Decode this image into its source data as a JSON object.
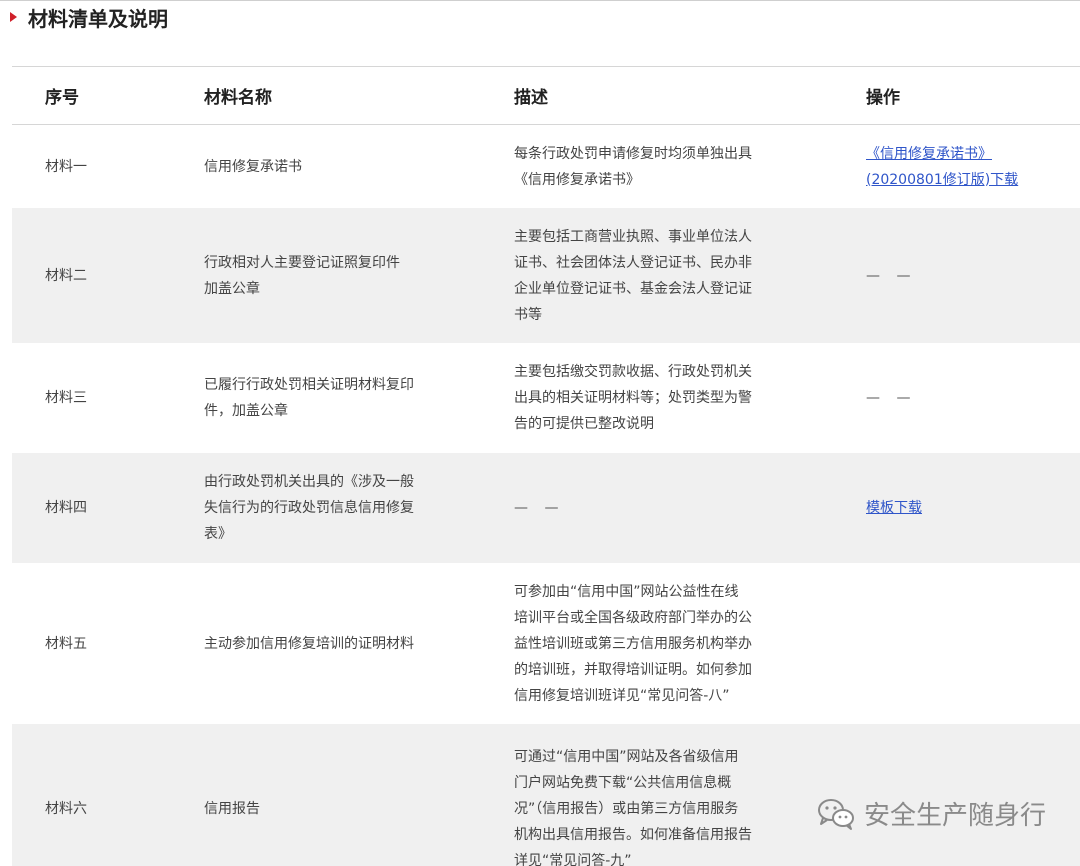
{
  "section": {
    "title": "材料清单及说明"
  },
  "table": {
    "headers": [
      "序号",
      "材料名称",
      "描述",
      "操作"
    ],
    "rows": [
      {
        "index": "材料一",
        "name": "信用修复承诺书",
        "description": "每条行政处罚申请修复时均须单独出具《信用修复承诺书》",
        "action": "《信用修复承诺书》(20200801修订版)下载"
      },
      {
        "index": "材料二",
        "name": "行政相对人主要登记证照复印件加盖公章",
        "description": "主要包括工商营业执照、事业单位法人证书、社会团体法人登记证书、民办非企业单位登记证书、基金会法人登记证书等",
        "action": "— —"
      },
      {
        "index": "材料三",
        "name": "已履行行政处罚相关证明材料复印件，加盖公章",
        "description": "主要包括缴交罚款收据、行政处罚机关出具的相关证明材料等；处罚类型为警告的可提供已整改说明",
        "action": "— —"
      },
      {
        "index": "材料四",
        "name": "由行政处罚机关出具的《涉及一般失信行为的行政处罚信息信用修复表》",
        "description": "— —",
        "action": "模板下载"
      },
      {
        "index": "材料五",
        "name": "主动参加信用修复培训的证明材料",
        "description": "可参加由“信用中国”网站公益性在线培训平台或全国各级政府部门举办的公益性培训班或第三方信用服务机构举办的培训班，并取得培训证明。如何参加信用修复培训班详见“常见问答-八”",
        "action": ""
      },
      {
        "index": "材料六",
        "name": "信用报告",
        "description": "可通过“信用中国”网站及各省级信用门户网站免费下载“公共信用信息概况”（信用报告）或由第三方信用服务机构出具信用报告。如何准备信用报告详见“常见问答-九”",
        "action": ""
      }
    ]
  },
  "lines": {
    "r1_desc": [
      "每条行政处罚申请修复时均须单独出具",
      "《信用修复承诺书》"
    ],
    "r1_action": [
      "《信用修复承诺书》",
      "(20200801修订版)下载"
    ],
    "r2_name": [
      "行政相对人主要登记证照复印件",
      "加盖公章"
    ],
    "r2_desc": [
      "主要包括工商营业执照、事业单位法人",
      "证书、社会团体法人登记证书、民办非",
      "企业单位登记证书、基金会法人登记证",
      "书等"
    ],
    "r3_name": [
      "已履行行政处罚相关证明材料复印",
      "件，加盖公章"
    ],
    "r3_desc": [
      "主要包括缴交罚款收据、行政处罚机关",
      "出具的相关证明材料等；处罚类型为警",
      "告的可提供已整改说明"
    ],
    "r4_name": [
      "由行政处罚机关出具的《涉及一般",
      "失信行为的行政处罚信息信用修复",
      "表》"
    ],
    "r5_desc": [
      "可参加由“信用中国”网站公益性在线",
      "培训平台或全国各级政府部门举办的公",
      "益性培训班或第三方信用服务机构举办",
      "的培训班，并取得培训证明。如何参加",
      "信用修复培训班详见“常见问答-八”"
    ],
    "r6_desc": [
      "可通过“信用中国”网站及各省级信用",
      "门户网站免费下载“公共信用信息概",
      "况”（信用报告）或由第三方信用服务",
      "机构出具信用报告。如何准备信用报告",
      "详见“常见问答-九”"
    ]
  },
  "watermark": {
    "text": "安全生产随身行",
    "icon": "wechat-icon"
  },
  "colors": {
    "accent": "#d0202a",
    "link": "#2f55c9",
    "alt_row": "#f0f0f0"
  }
}
